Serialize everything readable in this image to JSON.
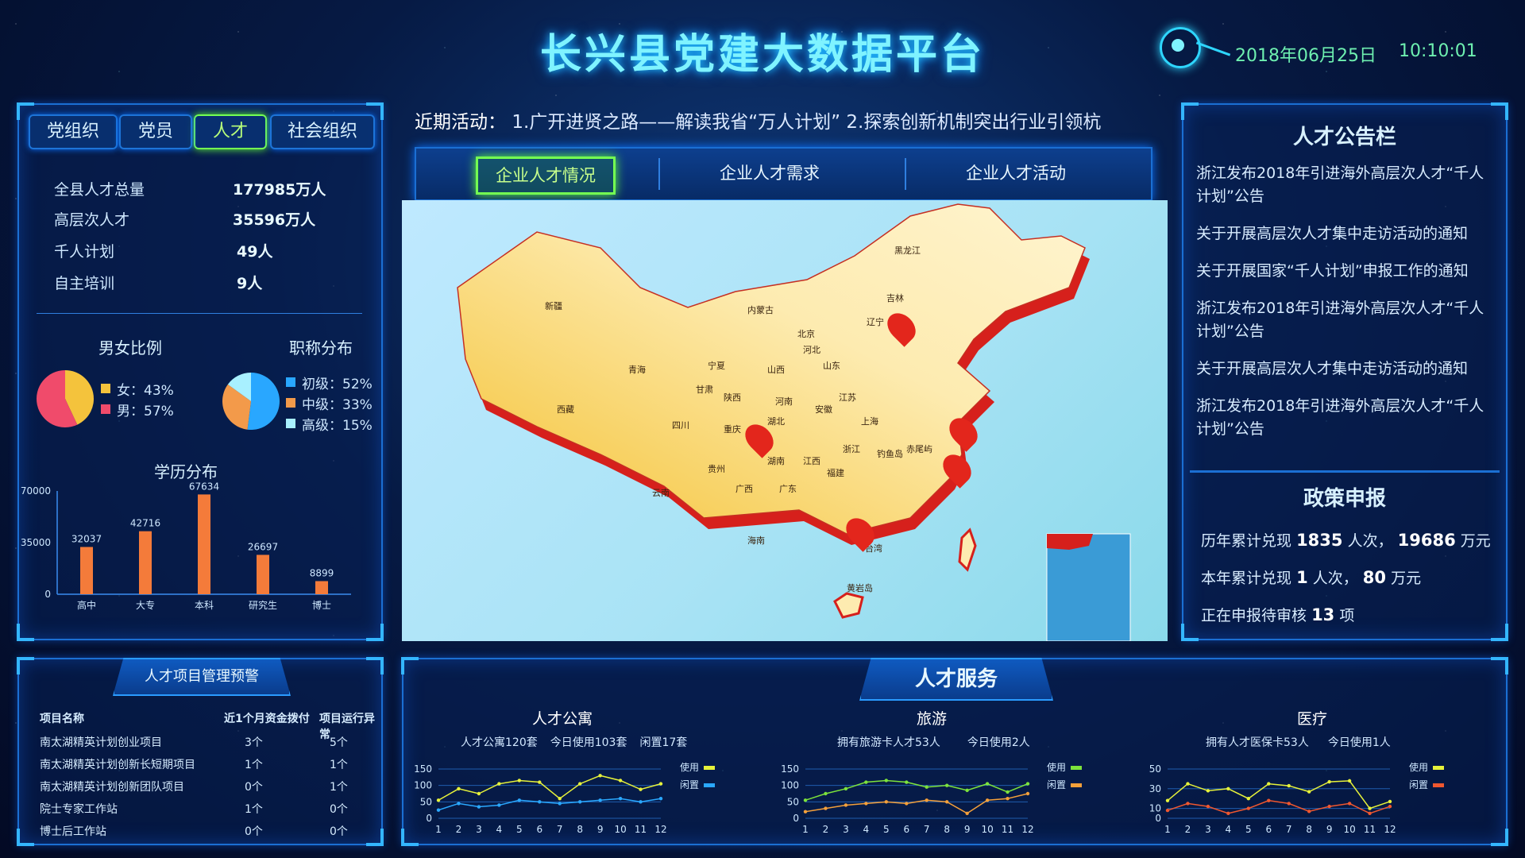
{
  "header": {
    "title": "长兴县党建大数据平台",
    "date": "2018年06月25日",
    "time": "10:10:01"
  },
  "left_tabs": [
    {
      "label": "党组织"
    },
    {
      "label": "党员"
    },
    {
      "label": "人才"
    },
    {
      "label": "社会组织"
    }
  ],
  "stats": [
    {
      "label": "全县人才总量",
      "value": "177985万人"
    },
    {
      "label": "高层次人才",
      "value": "35596万人"
    },
    {
      "label": "千人计划",
      "value": "49人"
    },
    {
      "label": "自主培训",
      "value": "9人"
    }
  ],
  "gender": {
    "title": "男女比例",
    "items": [
      {
        "label": "女：43%",
        "color": "#f4c33c",
        "value": 43
      },
      {
        "label": "男：57%",
        "color": "#f04b6b",
        "value": 57
      }
    ]
  },
  "titles": {
    "title": "职称分布",
    "items": [
      {
        "label": "初级：52%",
        "color": "#29a7ff",
        "value": 52
      },
      {
        "label": "中级：33%",
        "color": "#f39a4a",
        "value": 33
      },
      {
        "label": "高级：15%",
        "color": "#a8f0ff",
        "value": 15
      }
    ]
  },
  "chart_data": [
    {
      "type": "bar",
      "title": "学历分布",
      "categories": [
        "高中",
        "大专",
        "本科",
        "研究生",
        "博士"
      ],
      "values": [
        32037,
        42716,
        67634,
        26697,
        8899
      ],
      "ylim": [
        0,
        70000
      ],
      "yticks": [
        0,
        35000,
        70000
      ],
      "color": "#f47b3a"
    },
    {
      "type": "line",
      "title": "人才公寓",
      "x": [
        1,
        2,
        3,
        4,
        5,
        6,
        7,
        8,
        9,
        10,
        11,
        12
      ],
      "ylim": [
        0,
        150
      ],
      "yticks": [
        0,
        50,
        100,
        150
      ],
      "series": [
        {
          "name": "使用",
          "color": "#e7f23a",
          "values": [
            55,
            90,
            75,
            105,
            115,
            110,
            60,
            105,
            130,
            115,
            88,
            105
          ]
        },
        {
          "name": "闲置",
          "color": "#2aa8ff",
          "values": [
            25,
            45,
            35,
            40,
            55,
            50,
            45,
            50,
            55,
            60,
            50,
            60
          ]
        }
      ]
    },
    {
      "type": "line",
      "title": "旅游",
      "x": [
        1,
        2,
        3,
        4,
        5,
        6,
        7,
        8,
        9,
        10,
        11,
        12
      ],
      "ylim": [
        0,
        150
      ],
      "yticks": [
        0,
        50,
        100,
        150
      ],
      "series": [
        {
          "name": "使用",
          "color": "#7de33b",
          "values": [
            55,
            75,
            90,
            110,
            115,
            110,
            95,
            100,
            85,
            105,
            80,
            105
          ]
        },
        {
          "name": "闲置",
          "color": "#f5a03a",
          "values": [
            20,
            30,
            40,
            45,
            50,
            45,
            55,
            50,
            15,
            55,
            60,
            75
          ]
        }
      ]
    },
    {
      "type": "line",
      "title": "医疗",
      "x": [
        1,
        2,
        3,
        4,
        5,
        6,
        7,
        8,
        9,
        10,
        11,
        12
      ],
      "ylim": [
        0,
        50
      ],
      "yticks": [
        0,
        10,
        30,
        50
      ],
      "series": [
        {
          "name": "使用",
          "color": "#e7f23a",
          "values": [
            18,
            35,
            28,
            30,
            20,
            35,
            33,
            27,
            37,
            38,
            10,
            17
          ]
        },
        {
          "name": "闲置",
          "color": "#f0572f",
          "values": [
            8,
            15,
            12,
            5,
            10,
            18,
            15,
            7,
            12,
            15,
            5,
            12
          ]
        }
      ]
    }
  ],
  "marquee": {
    "label": "近期活动：",
    "text": "1.广开进贤之路——解读我省“万人计划”   2.探索创新机制突出行业引领杭"
  },
  "map_tabs": [
    {
      "label": "企业人才情况"
    },
    {
      "label": "企业人才需求"
    },
    {
      "label": "企业人才活动"
    }
  ],
  "map": {
    "provinces": [
      "黑龙江",
      "吉林",
      "辽宁",
      "内蒙古",
      "新疆",
      "青海",
      "西藏",
      "甘肃",
      "宁夏",
      "陕西",
      "山西",
      "河北",
      "山东",
      "河南",
      "江苏",
      "安徽",
      "湖北",
      "四川",
      "重庆",
      "贵州",
      "湖南",
      "江西",
      "浙江",
      "福建",
      "广西",
      "广东",
      "云南",
      "海南",
      "台湾",
      "北京",
      "上海",
      "钓鱼岛",
      "赤尾屿",
      "黄岩岛"
    ]
  },
  "notice": {
    "title": "人才公告栏",
    "items": [
      "浙江发布2018年引进海外高层次人才“千人计划”公告",
      "关于开展高层次人才集中走访活动的通知",
      "关于开展国家“千人计划”申报工作的通知",
      "浙江发布2018年引进海外高层次人才“千人计划”公告",
      "关于开展高层次人才集中走访活动的通知",
      "浙江发布2018年引进海外高层次人才“千人计划”公告"
    ]
  },
  "policy": {
    "title": "政策申报",
    "rows": [
      {
        "pre": "历年累计兑现",
        "v1": "1835",
        "m": "人次，",
        "v2": "19686",
        "post": "万元"
      },
      {
        "pre": "本年累计兑现",
        "v1": "1",
        "m": "人次，",
        "v2": "80",
        "post": "万元"
      },
      {
        "pre": "正在申报待审核",
        "v1": "13",
        "m": "项",
        "v2": "",
        "post": ""
      }
    ]
  },
  "project_warning": {
    "title": "人才项目管理预警",
    "headers": [
      "项目名称",
      "近1个月资金拨付",
      "项目运行异常"
    ],
    "rows": [
      [
        "南太湖精英计划创业项目",
        "3个",
        "5个"
      ],
      [
        "南太湖精英计划创新长短期项目",
        "1个",
        "1个"
      ],
      [
        "南太湖精英计划创新团队项目",
        "0个",
        "1个"
      ],
      [
        "院士专家工作站",
        "1个",
        "0个"
      ],
      [
        "博士后工作站",
        "0个",
        "0个"
      ]
    ]
  },
  "services": {
    "title": "人才服务",
    "blocks": [
      {
        "title": "人才公寓",
        "sub1": "人才公寓120套",
        "sub2": "今日使用103套",
        "sub3": "闲置17套"
      },
      {
        "title": "旅游",
        "sub1": "拥有旅游卡人才53人",
        "sub2": "今日使用2人",
        "sub3": ""
      },
      {
        "title": "医疗",
        "sub1": "拥有人才医保卡53人",
        "sub2": "今日使用1人",
        "sub3": ""
      }
    ]
  }
}
